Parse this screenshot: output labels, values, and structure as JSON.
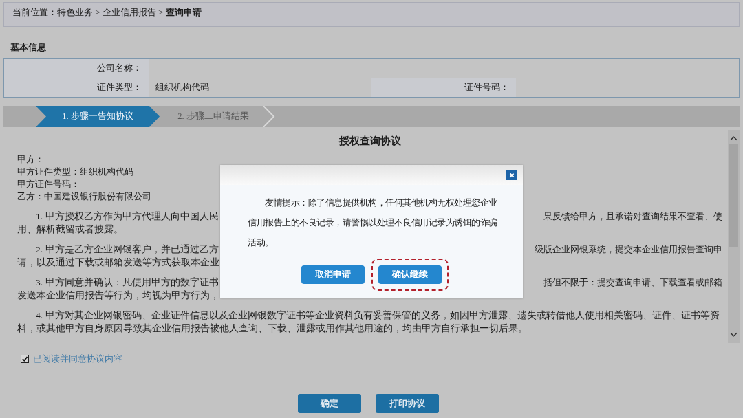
{
  "breadcrumb": "当前位置：特色业务 > 企业信用报告 > **查询申请**",
  "section_title": "基本信息",
  "company_name": {
    "label": "公司名称："
  },
  "id_type": {
    "label": "证件类型：",
    "value": "组织机构代码"
  },
  "id_number": {
    "label": "证件号码："
  },
  "steps": [
    {
      "label": "1. 步骤一告知协议",
      "selected": true
    },
    {
      "label": "2. 步骤二申请结果",
      "selected": false
    }
  ],
  "agreement": {
    "title": "授权查询协议",
    "parties": [
      "甲方：",
      "甲方证件类型：组织机构代码",
      "甲方证件号码：",
      "乙方：中国建设银行股份有限公司"
    ],
    "paragraphs": [
      {
        "kind": "split",
        "lines": [
          {
            "left": "1. 甲方授权乙方作为甲方代理人向中国人民",
            "right": "果反馈给甲方，且承诺对查询结果不查看、使"
          },
          {
            "left": "用、解析截留或者披露。"
          }
        ]
      },
      {
        "kind": "split",
        "lines": [
          {
            "left": "2. 甲方是乙方企业网银客户，并已通过乙方",
            "right": "级版企业网银系统，提交本企业信用报告查询申"
          },
          {
            "left": "请，以及通过下载或邮箱发送等方式获取本企业"
          }
        ]
      },
      {
        "kind": "split",
        "lines": [
          {
            "left": "3.  甲方同意并确认：凡使用甲方的数字证书",
            "right": "括但不限于：提交查询申请、下载查看或邮箱"
          },
          {
            "left": "发送本企业信用报告等行为，均视为甲方行为，"
          }
        ]
      },
      {
        "kind": "full",
        "text": "4. 甲方对其企业网银密码、企业证件信息以及企业网银数字证书等企业资料负有妥善保管的义务，如因甲方泄露、遗失或转借他人使用相关密码、证件、证书等资料，或其他甲方自身原因导致其企业信用报告被他人查询、下载、泄露或用作其他用途的，均由甲方自行承担一切后果。"
      }
    ]
  },
  "consent": {
    "label": "已阅读并同意协议内容",
    "checked": true
  },
  "actions": [
    "确定",
    "打印协议"
  ],
  "dialog": {
    "message": "友情提示：除了信息提供机构，任何其他机构无权处理您企业信用报告上的不良记录，请警惕以处理不良信用记录为诱饵的诈骗活动。",
    "buttons": [
      {
        "label": "取消申请",
        "highlighted": false
      },
      {
        "label": "确认继续",
        "highlighted": true
      }
    ]
  }
}
